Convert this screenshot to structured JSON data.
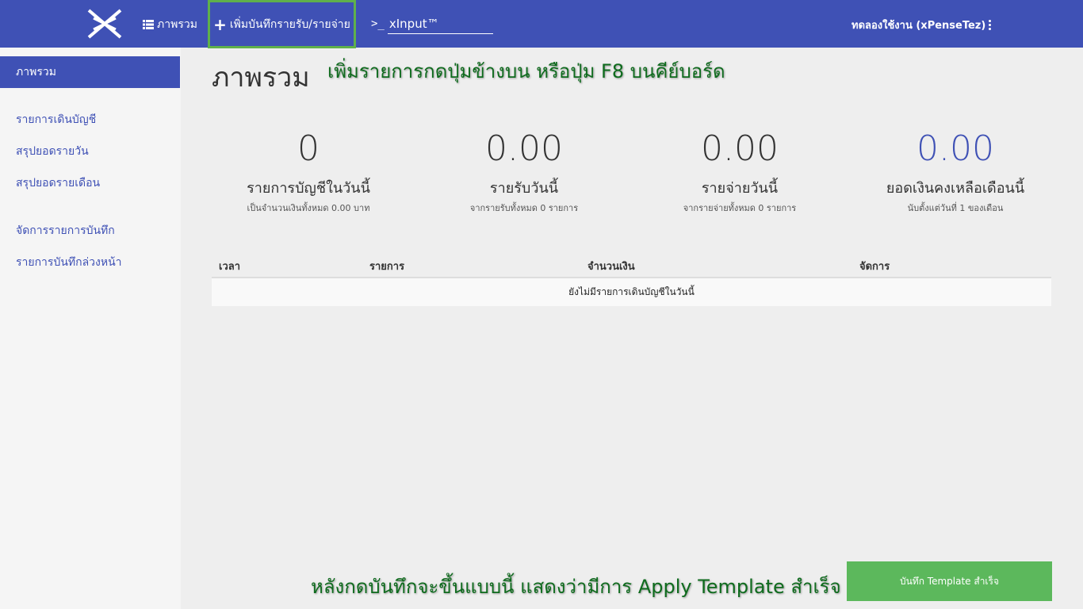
{
  "navbar": {
    "overview_label": "ภาพรวม",
    "add_record_label": "เพิ่มบันทึกรายรับ/รายจ่าย",
    "xinput_prompt": ">_",
    "xinput_label": "xInput™",
    "user_label": "ทดลองใช้งาน (xPenseTez)"
  },
  "sidebar": {
    "items": [
      {
        "label": "ภาพรวม",
        "active": true
      },
      {
        "label": "รายการเดินบัญชี"
      },
      {
        "label": "สรุปยอดรายวัน"
      },
      {
        "label": "สรุปยอดรายเดือน"
      },
      {
        "label": "จัดการรายการบันทึก"
      },
      {
        "label": "รายการบันทึกล่วงหน้า"
      }
    ]
  },
  "page": {
    "title": "ภาพรวม"
  },
  "annotations": {
    "top": "เพิ่มรายการกดปุ่มข้างบน หรือปุ่ม F8 บนคีย์บอร์ด",
    "bottom": "หลังกดบันทึกจะขึ้นแบบนี้ แสดงว่ามีการ Apply Template สำเร็จ -->"
  },
  "stats": [
    {
      "value": "0",
      "label": "รายการบัญชีในวันนี้",
      "sub": "เป็นจำนวนเงินทั้งหมด 0.00 บาท"
    },
    {
      "value": "0.00",
      "label": "รายรับวันนี้",
      "sub": "จากรายรับทั้งหมด 0 รายการ"
    },
    {
      "value": "0.00",
      "label": "รายจ่ายวันนี้",
      "sub": "จากรายจ่ายทั้งหมด 0 รายการ"
    },
    {
      "value": "0.00",
      "label": "ยอดเงินคงเหลือเดือนนี้",
      "sub": "นับตั้งแต่วันที่ 1 ของเดือน"
    }
  ],
  "table": {
    "columns": [
      "เวลา",
      "รายการ",
      "จำนวนเงิน",
      "จัดการ"
    ],
    "empty_message": "ยังไม่มีรายการเดินบัญชีในวันนี้"
  },
  "toast": {
    "message": "บันทึก Template สำเร็จ"
  },
  "colors": {
    "primary": "#3f51b5",
    "success": "#5cb85c",
    "highlight_border": "#5fb04b",
    "annotation": "#0e6b1d"
  },
  "icons": {
    "logo": "x-logo-icon",
    "overview": "list-icon",
    "add": "plus-icon",
    "terminal": "terminal-prompt-icon",
    "user_menu": "kebab-menu-icon"
  }
}
